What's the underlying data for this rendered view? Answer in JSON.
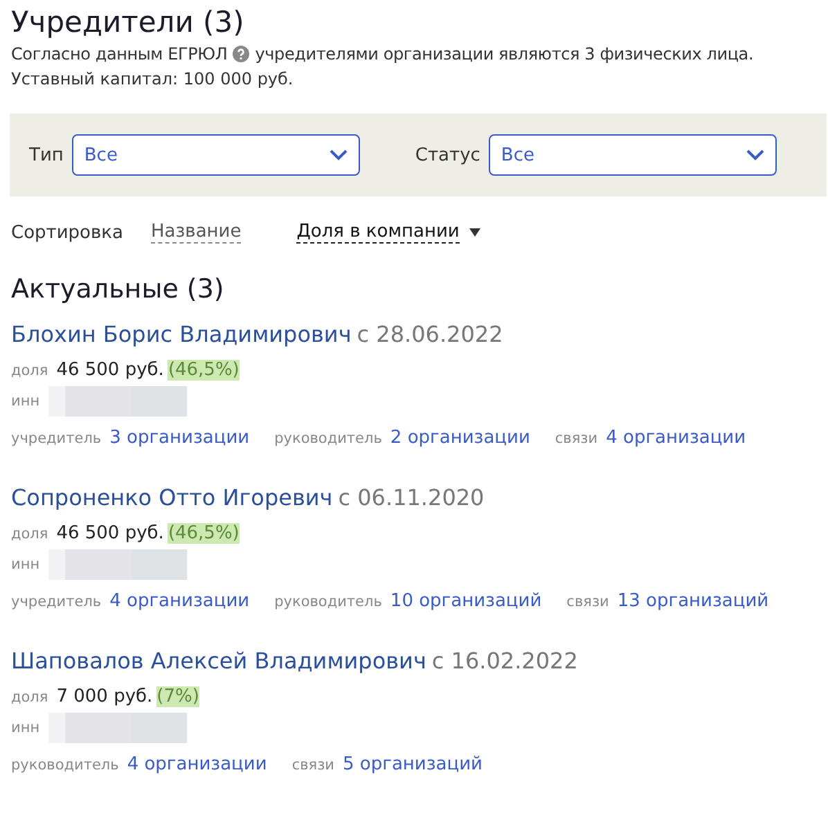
{
  "title": "Учредители (3)",
  "description": {
    "before": "Согласно данным ЕГРЮЛ",
    "after": "учредителями организации являются 3 физических лица."
  },
  "capital": "Уставный капитал: 100 000 руб.",
  "filters": [
    {
      "label": "Тип",
      "value": "Все"
    },
    {
      "label": "Статус",
      "value": "Все"
    }
  ],
  "sort": {
    "label": "Сортировка",
    "options": [
      {
        "label": "Название",
        "selected": false
      },
      {
        "label": "Доля в компании",
        "selected": true
      }
    ]
  },
  "section_title": "Актуальные (3)",
  "founders": [
    {
      "name": "Блохин Борис Владимирович",
      "since": "с 28.06.2022",
      "share_label": "доля",
      "share": "46 500 руб.",
      "percent": "(46,5%)",
      "inn_label": "инн",
      "roles": [
        {
          "label": "учредитель",
          "link": "3 организации"
        },
        {
          "label": "руководитель",
          "link": "2 организации"
        },
        {
          "label": "связи",
          "link": "4 организации"
        }
      ]
    },
    {
      "name": "Сопроненко Отто Игоревич",
      "since": "с 06.11.2020",
      "share_label": "доля",
      "share": "46 500 руб.",
      "percent": "(46,5%)",
      "inn_label": "инн",
      "roles": [
        {
          "label": "учредитель",
          "link": "4 организации"
        },
        {
          "label": "руководитель",
          "link": "10 организаций"
        },
        {
          "label": "связи",
          "link": "13 организаций"
        }
      ]
    },
    {
      "name": "Шаповалов Алексей Владимирович",
      "since": "с 16.02.2022",
      "share_label": "доля",
      "share": "7 000 руб.",
      "percent": "(7%)",
      "inn_label": "инн",
      "roles": [
        {
          "label": "руководитель",
          "link": "4 организации"
        },
        {
          "label": "связи",
          "link": "5 организаций"
        }
      ]
    }
  ]
}
